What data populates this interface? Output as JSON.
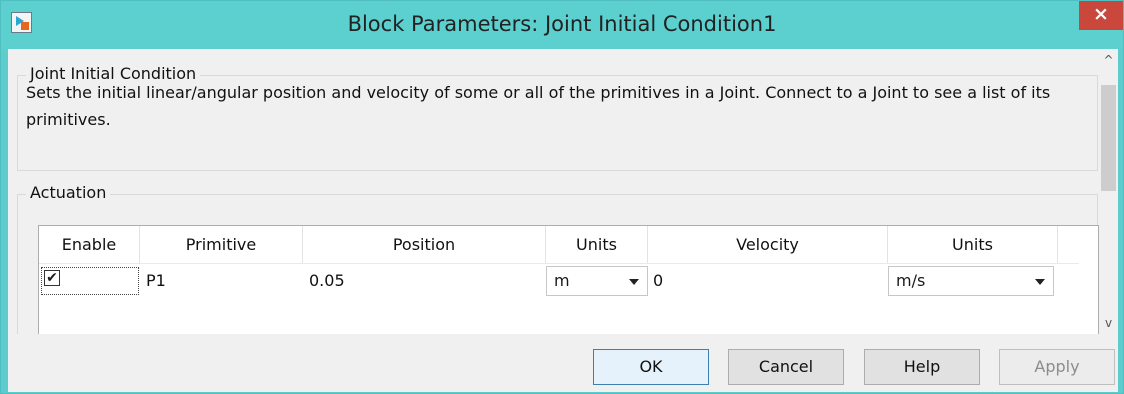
{
  "window": {
    "title": "Block Parameters: Joint Initial Condition1",
    "close_glyph": "×",
    "app_icon": "simulink-block-icon"
  },
  "header_group": {
    "legend": "Joint Initial Condition",
    "description": "Sets the initial linear/angular position and velocity of some or all of the primitives in a Joint. Connect to a Joint to see a list of its primitives."
  },
  "actuation": {
    "legend": "Actuation",
    "columns": [
      "Enable",
      "Primitive",
      "Position",
      "Units",
      "Velocity",
      "Units"
    ],
    "rows": [
      {
        "enabled": true,
        "check_glyph": "✔",
        "primitive": "P1",
        "position": "0.05",
        "position_units": "m",
        "velocity": "0",
        "velocity_units": "m/s"
      }
    ]
  },
  "scrollbar": {
    "up_glyph": "^",
    "down_glyph": "v"
  },
  "buttons": {
    "ok": "OK",
    "cancel": "Cancel",
    "help": "Help",
    "apply": "Apply"
  },
  "colors": {
    "titlebar": "#5ccfcf",
    "close": "#c9473b",
    "dialog_bg": "#f0f0f0"
  }
}
